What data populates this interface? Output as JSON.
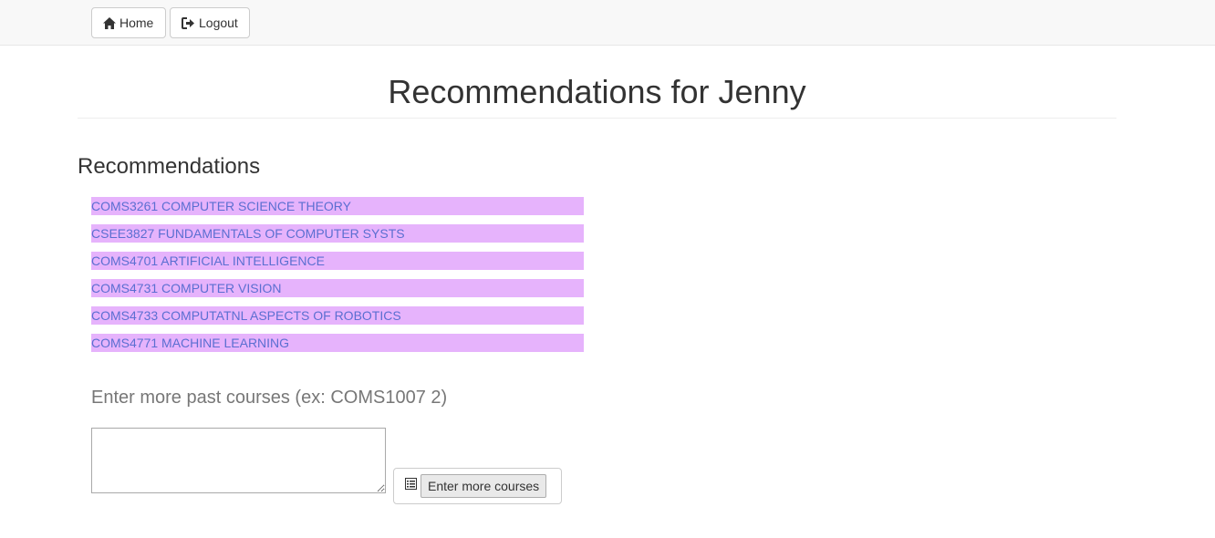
{
  "nav": {
    "home_label": "Home",
    "logout_label": "Logout"
  },
  "page": {
    "title": "Recommendations for Jenny"
  },
  "recommendations": {
    "heading": "Recommendations",
    "items": [
      "COMS3261 COMPUTER SCIENCE THEORY",
      "CSEE3827 FUNDAMENTALS OF COMPUTER SYSTS",
      "COMS4701 ARTIFICIAL INTELLIGENCE",
      "COMS4731 COMPUTER VISION",
      "COMS4733 COMPUTATNL ASPECTS OF ROBOTICS",
      "COMS4771 MACHINE LEARNING"
    ],
    "highlight_color": "#e6b3fc",
    "text_color": "#5b6fd1"
  },
  "form": {
    "label": "Enter more past courses (ex: COMS1007 2)",
    "input_value": "",
    "submit_label": "Enter more courses"
  },
  "icons": {
    "home": "home-icon",
    "logout": "logout-icon",
    "submit": "list-icon"
  }
}
